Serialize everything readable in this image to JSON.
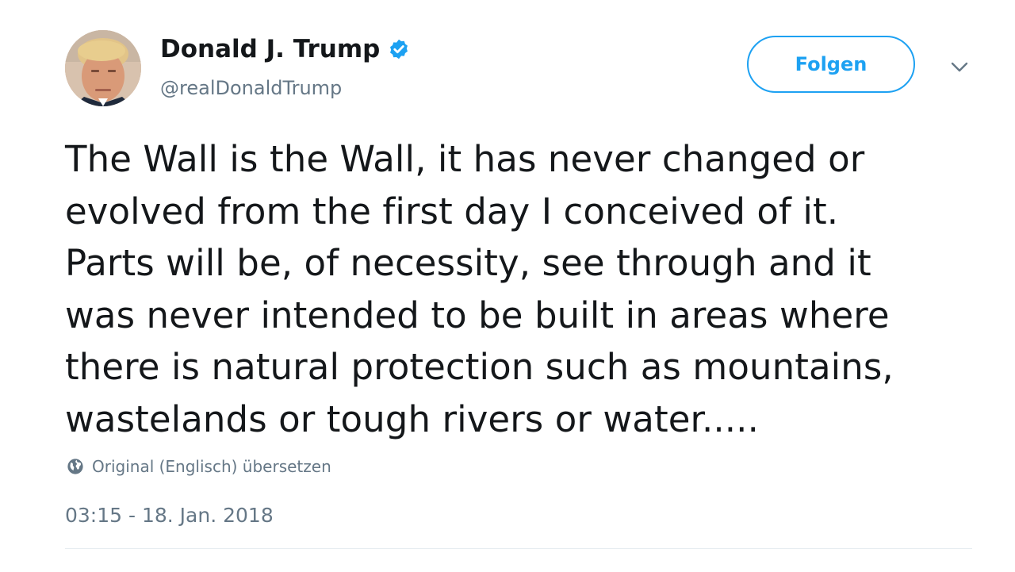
{
  "author": {
    "display_name": "Donald J. Trump",
    "handle": "@realDonaldTrump",
    "verified": true
  },
  "actions": {
    "follow_label": "Folgen"
  },
  "tweet": {
    "lines": [
      "The Wall is the Wall, it has never changed or",
      "evolved from the first day I conceived of it.",
      "Parts will be, of necessity, see through and it",
      "was never intended to be built in areas where",
      "there is natural protection such as mountains,",
      "wastelands or tough rivers or water....."
    ],
    "translate_label": "Original (Englisch) übersetzen",
    "timestamp": "03:15 - 18. Jan. 2018"
  },
  "colors": {
    "accent": "#1da1f2",
    "text": "#14171a",
    "secondary_text": "#657786",
    "divider": "#e6ecf0"
  },
  "icons": {
    "verified": "verified-badge-icon",
    "caret": "chevron-down-icon",
    "translate": "globe-icon"
  }
}
